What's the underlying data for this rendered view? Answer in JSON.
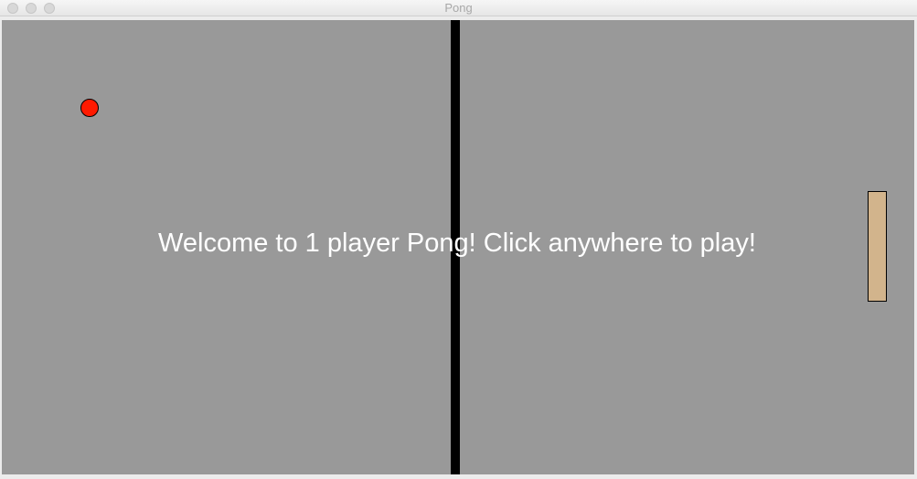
{
  "window": {
    "title": "Pong"
  },
  "game": {
    "message": "Welcome to 1 player Pong! Click anywhere to play!",
    "colors": {
      "court": "#999999",
      "net": "#000000",
      "ball": "#ff1a00",
      "paddle": "#d2b48c",
      "message_text": "#ffffff"
    }
  }
}
